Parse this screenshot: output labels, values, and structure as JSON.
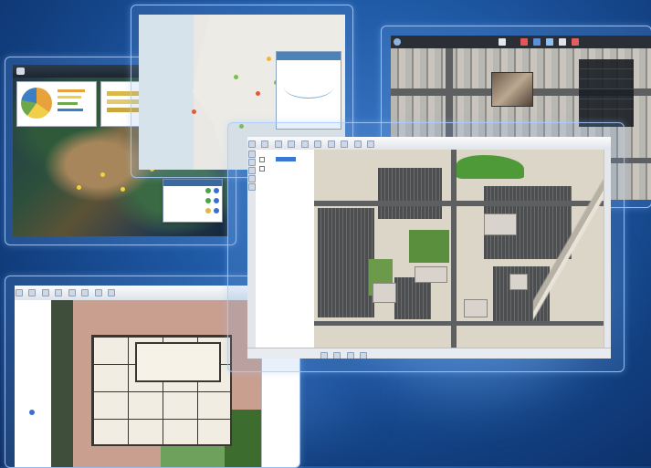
{
  "colors": {
    "background": "#1f5aa6",
    "frame_border": "#aacdff",
    "map_green": "#4f8d3a",
    "asphalt": "#5d5f61"
  },
  "panel_dashboard": {
    "title": "",
    "legend_rows": [
      "",
      "",
      ""
    ]
  },
  "panel_web_map": {
    "popup_title": ""
  },
  "panel_3d_viewer": {
    "title": "",
    "menu_items": [
      "",
      "",
      "",
      "",
      "",
      ""
    ]
  },
  "panel_desktop_gis": {
    "layers": [
      "",
      ""
    ]
  },
  "panel_floorplan": {
    "toc_items": [
      "",
      "",
      "",
      "",
      "",
      "",
      "",
      ""
    ]
  }
}
